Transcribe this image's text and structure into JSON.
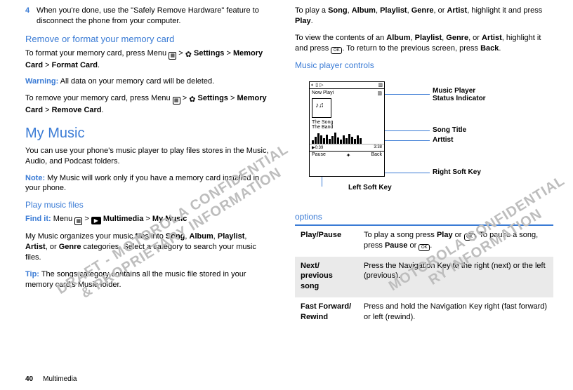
{
  "left": {
    "step": {
      "num": "4",
      "text": "When you're done, use the \"Safely Remove Hardware\" feature to disconnect the phone from your computer."
    },
    "h1": "Remove or format your memory card",
    "p1a": "To format your memory card, press Menu ",
    "p1b": " > ",
    "p1_settings": "Settings",
    "p1c": " > ",
    "p1_mc": "Memory Card",
    "p1d": " > ",
    "p1_fc": "Format Card",
    "p1e": ".",
    "warn_lbl": "Warning:",
    "warn_txt": " All data on your memory card will be deleted.",
    "p2a": "To remove your memory card, press Menu ",
    "p2_rc": "Remove Card",
    "h2": "My Music",
    "mm_p1": "You can use your phone's music player to play files stores in the Music, Audio, and Podcast folders.",
    "note_lbl": "Note:",
    "note_txt": " My Music will work only if you have a memory card installed in your phone.",
    "h3": "Play music files",
    "find_lbl": "Find it:",
    "find_a": " Menu ",
    "find_mm": "Multimedia",
    "find_b": " > ",
    "find_my": "My Music",
    "pm1a": "My Music organizes your music files into ",
    "song": "Song",
    "album": "Album",
    "playlist": "Playlist",
    "artist": "Artist",
    "genre": "Genre",
    "pm1b": ", ",
    "pm1c": ", ",
    "pm1d": ", ",
    "pm1e": ", or ",
    "pm1f": " categories. Select a category to search your music files.",
    "tip_lbl": "Tip:",
    "tip_txt": " The songs category contains all the music file stored in your memory card's Music folder."
  },
  "right": {
    "p1a": "To play a ",
    "play": "Play",
    "p1b": ", highlight it and press ",
    "p1c": ".",
    "p2a": "To view the contents of an ",
    "p2b": ", highlight it and press ",
    "p2c": ". To return to the previous screen, press ",
    "back": "Back",
    "p2d": ".",
    "h1": "Music player controls",
    "diagram": {
      "nowplaying": "Now Playi",
      "song": "The Song",
      "band": "The Band",
      "t0": "0:39",
      "t1": "3:38",
      "pause": "Pause",
      "backsk": "Back",
      "c1": "Music Player",
      "c1b": "Status Indicator",
      "c2": "Song Title",
      "c3": "Arttist",
      "c4": "Right Soft Key",
      "lsk": "Left Soft Key"
    },
    "options": "options",
    "row1k": "Play/Pause",
    "row1a": "To play a song press ",
    "row1b": " or ",
    "row1c": ". To pause a song, press ",
    "pause": "Pause",
    "row1d": " or ",
    "row1e": ".",
    "row2k": "Next/\nprevious song",
    "row2v": "Press the Navigation Key to the right (next) or the left (previous).",
    "row3k": "Fast Forward/\nRewind",
    "row3v": "Press and hold the Navigation Key right (fast forward) or left (rewind)."
  },
  "footer": {
    "page": "40",
    "section": "Multimedia"
  },
  "wm1": "DRAFT - MOTOROLA CONFIDENTIAL\n& PROPRIETARY INFORMATION",
  "wm2": "MOTOROLA CONFIDENTIAL\nRY INFORMATION"
}
